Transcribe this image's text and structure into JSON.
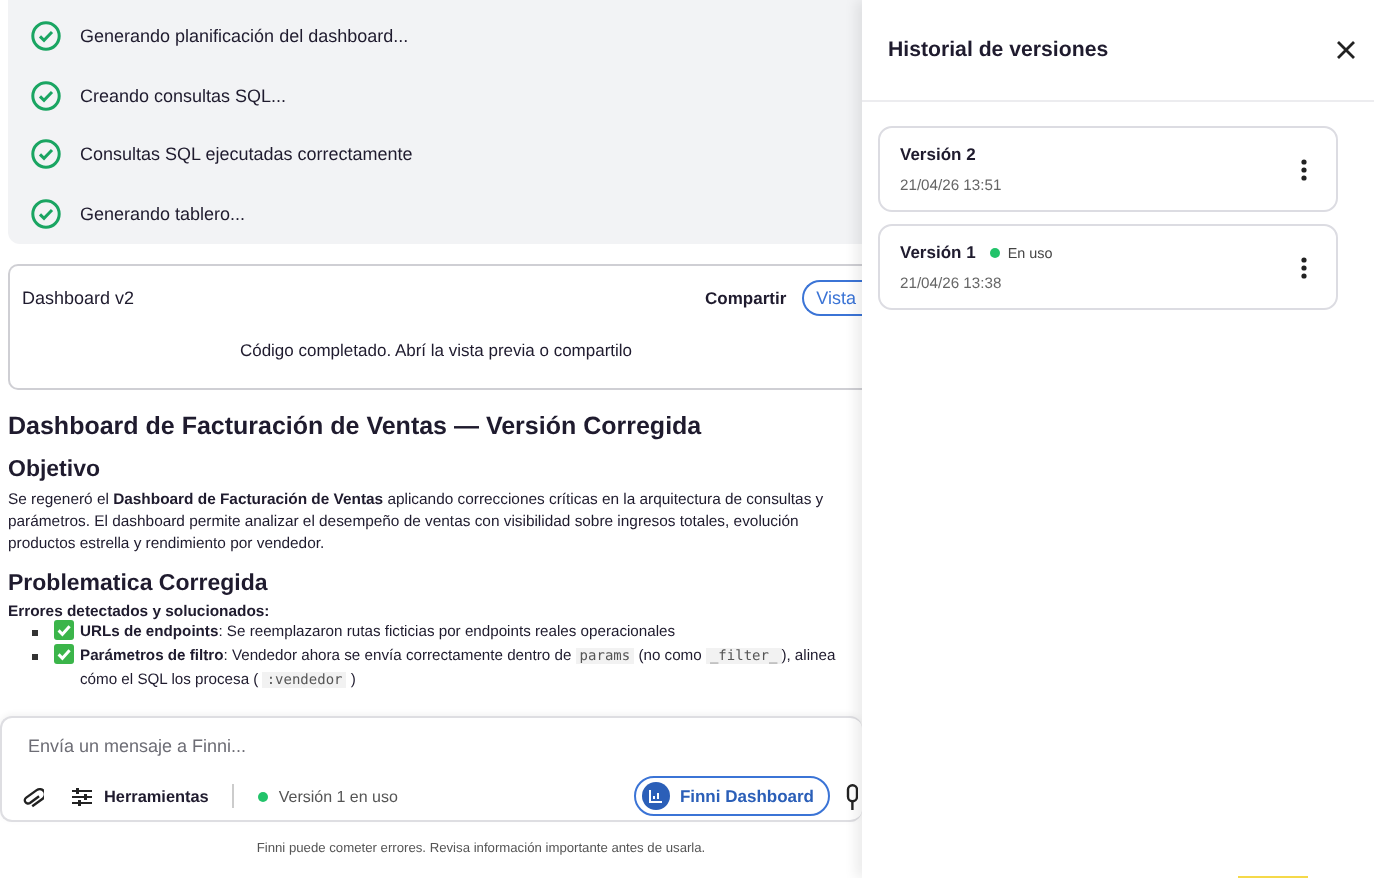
{
  "steps": [
    {
      "label": "Generando planificación del dashboard...",
      "done": true
    },
    {
      "label": "Creando consultas SQL...",
      "done": true
    },
    {
      "label": "Consultas SQL ejecutadas correctamente",
      "done": true
    },
    {
      "label": "Generando tablero...",
      "done": true
    }
  ],
  "artifact": {
    "title": "Dashboard v2",
    "share": "Compartir",
    "view": "Vista",
    "message": "Código completado. Abrí la vista previa o compartilo"
  },
  "report": {
    "title": "Dashboard de Facturación de Ventas — Versión Corregida",
    "sections": [
      {
        "heading": "Objetivo",
        "paragraph_lines": [
          "Se regeneró el **Dashboard de Facturación de Ventas** aplicando correcciones críticas en la arquitectura de consultas y",
          "parámetros. El dashboard permite analizar el desempeño de ventas con visibilidad sobre ingresos totales, evolución",
          "productos estrella y rendimiento por vendedor."
        ]
      },
      {
        "heading": "Problematica Corregida",
        "subheading": "Errores detectados y solucionados:",
        "bullets": [
          [
            {
              "kind": "bold",
              "text": "URLs de endpoints"
            },
            {
              "kind": "text",
              "text": ": Se reemplazaron rutas ficticias por endpoints reales operacionales"
            }
          ],
          [
            {
              "kind": "bold",
              "text": "Parámetros de filtro"
            },
            {
              "kind": "text",
              "text": ": Vendedor ahora se envía correctamente dentro de "
            },
            {
              "kind": "code",
              "text": "params"
            },
            {
              "kind": "text",
              "text": " (no como "
            },
            {
              "kind": "code",
              "text": "_filter_"
            },
            {
              "kind": "text",
              "text": "), alinea"
            },
            {
              "kind": "break"
            },
            {
              "kind": "text",
              "text": "cómo el SQL los procesa ( "
            },
            {
              "kind": "code",
              "text": ":vendedor"
            },
            {
              "kind": "text",
              "text": " )"
            }
          ]
        ]
      }
    ]
  },
  "composer": {
    "placeholder": "Envía un mensaje a Finni...",
    "tools": "Herramientas",
    "version_status": "Versión 1 en uso",
    "agent": "Finni Dashboard"
  },
  "disclaimer": "Finni puede cometer errores. Revisa información importante antes de usarla.",
  "versions_panel": {
    "title": "Historial de versiones",
    "items": [
      {
        "name": "Versión 2",
        "date": "21/04/26 13:51",
        "in_use": false
      },
      {
        "name": "Versión 1",
        "date": "21/04/26 13:38",
        "in_use": true,
        "badge": "En uso"
      }
    ]
  }
}
